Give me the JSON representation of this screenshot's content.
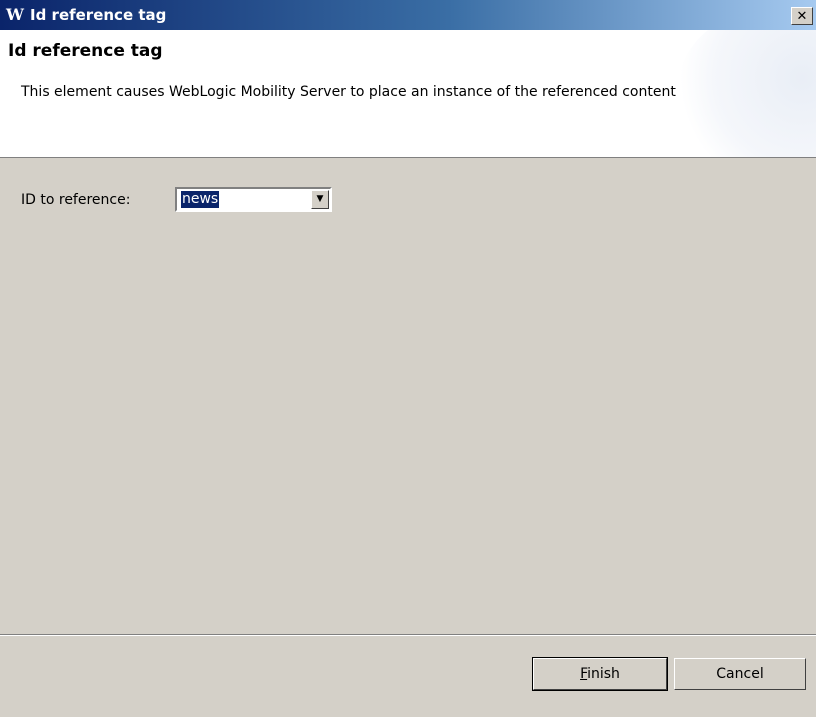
{
  "window": {
    "title": "Id reference tag",
    "app_icon_glyph": "W",
    "close_glyph": "✕"
  },
  "header": {
    "title": "Id reference tag",
    "description": "This element causes WebLogic Mobility Server to place an instance of the referenced content"
  },
  "form": {
    "id_label": "ID to reference:",
    "id_value": "news",
    "dropdown_arrow": "▼"
  },
  "buttons": {
    "finish_mnemonic": "F",
    "finish_rest": "inish",
    "cancel": "Cancel"
  },
  "icons": {
    "app": "weblogic-app-icon",
    "close": "close-icon",
    "dropdown": "chevron-down-icon"
  }
}
